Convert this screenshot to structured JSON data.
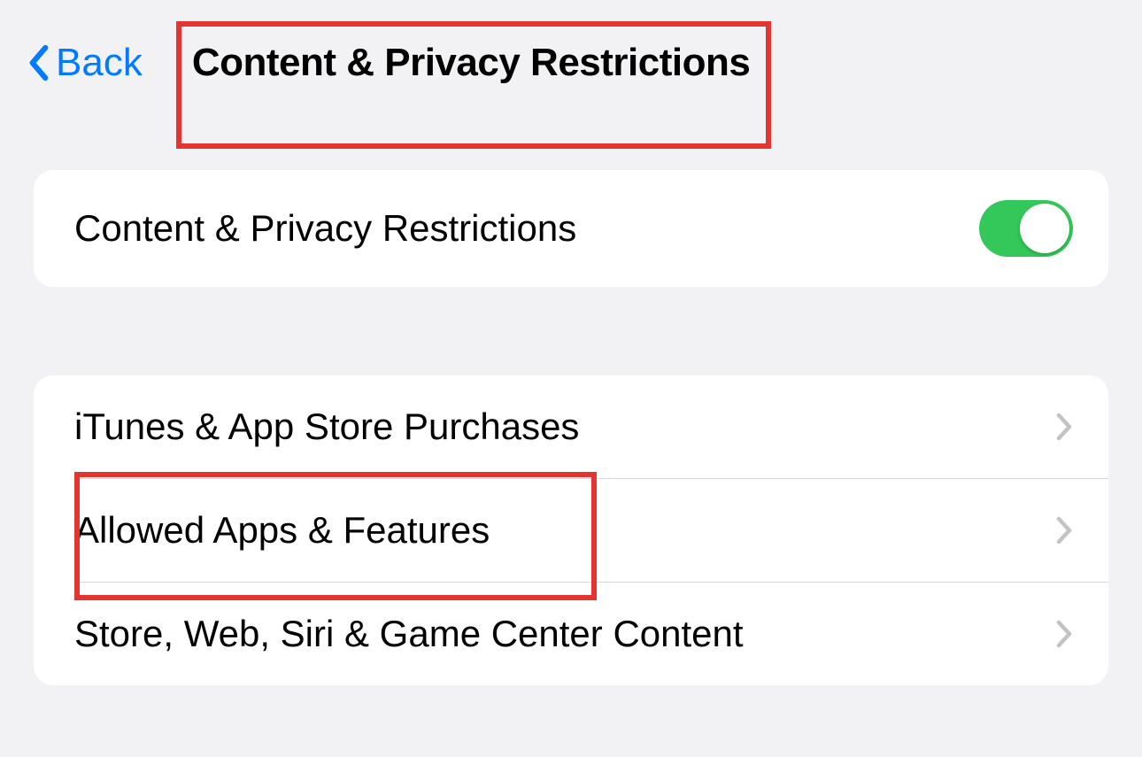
{
  "header": {
    "back_label": "Back",
    "title": "Content & Privacy Restrictions"
  },
  "main_toggle": {
    "label": "Content & Privacy Restrictions",
    "enabled": true
  },
  "menu_items": [
    {
      "label": "iTunes & App Store Purchases"
    },
    {
      "label": "Allowed Apps & Features"
    },
    {
      "label": "Store, Web, Siri & Game Center Content"
    }
  ]
}
